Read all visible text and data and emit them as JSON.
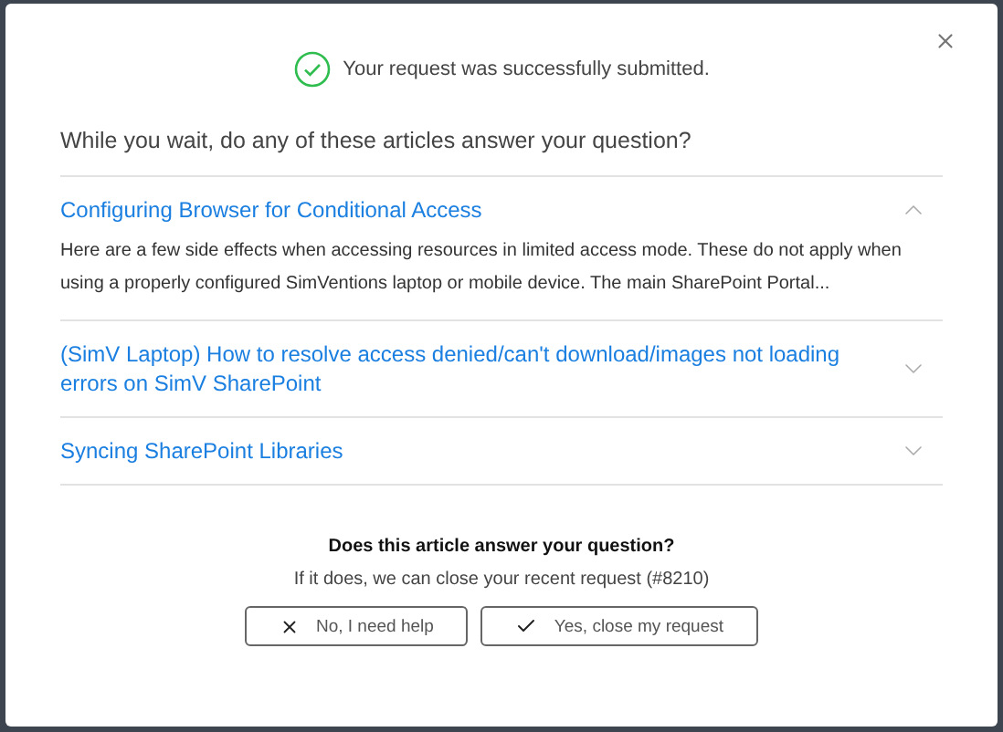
{
  "status": {
    "message": "Your request was successfully submitted."
  },
  "prompt": "While you wait, do any of these articles answer your question?",
  "articles": [
    {
      "title": "Configuring Browser for Conditional Access",
      "expanded": true,
      "excerpt": "Here are a few side effects when accessing resources in limited access mode. These do not apply when using a properly configured SimVentions laptop or mobile device. The main SharePoint Portal..."
    },
    {
      "title": "(SimV Laptop) How to resolve access denied/can't download/images not loading errors on SimV SharePoint",
      "expanded": false
    },
    {
      "title": "Syncing SharePoint Libraries",
      "expanded": false
    }
  ],
  "feedback": {
    "question": "Does this article answer your question?",
    "note": "If it does, we can close your recent request (#8210)"
  },
  "buttons": [
    {
      "label": "No, I need help",
      "kind": "decline"
    },
    {
      "label": "Yes, close my request",
      "kind": "accept"
    }
  ]
}
